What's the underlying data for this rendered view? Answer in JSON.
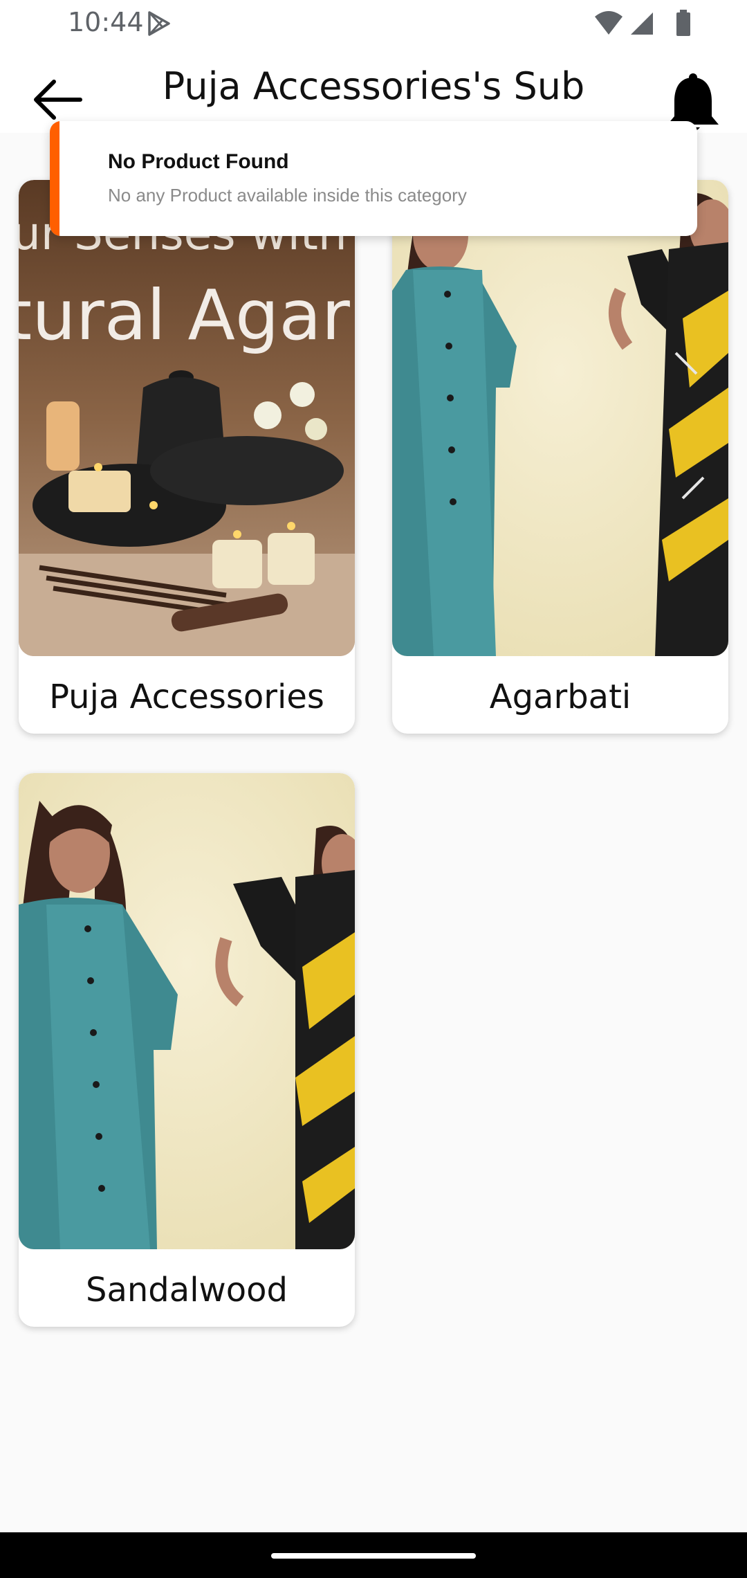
{
  "status_bar": {
    "time": "10:44",
    "icons": [
      "play-icon",
      "wifi-icon",
      "signal-icon",
      "battery-icon"
    ]
  },
  "header": {
    "title": "Puja Accessories's Sub Category",
    "back_icon": "arrow-back-icon",
    "notification_icon": "bell-icon"
  },
  "toast": {
    "title": "No Product Found",
    "message": "No any Product available inside this category",
    "accent_color": "#ff5f00"
  },
  "categories": [
    {
      "label": "Puja Accessories",
      "image": "agarbatti-candles-banner"
    },
    {
      "label": "Agarbati",
      "image": "kurti-models"
    },
    {
      "label": "Sandalwood",
      "image": "kurti-models"
    }
  ],
  "colors": {
    "background": "#fafafa",
    "card": "#ffffff",
    "text": "#111111",
    "toast_accent": "#ff5f00"
  }
}
